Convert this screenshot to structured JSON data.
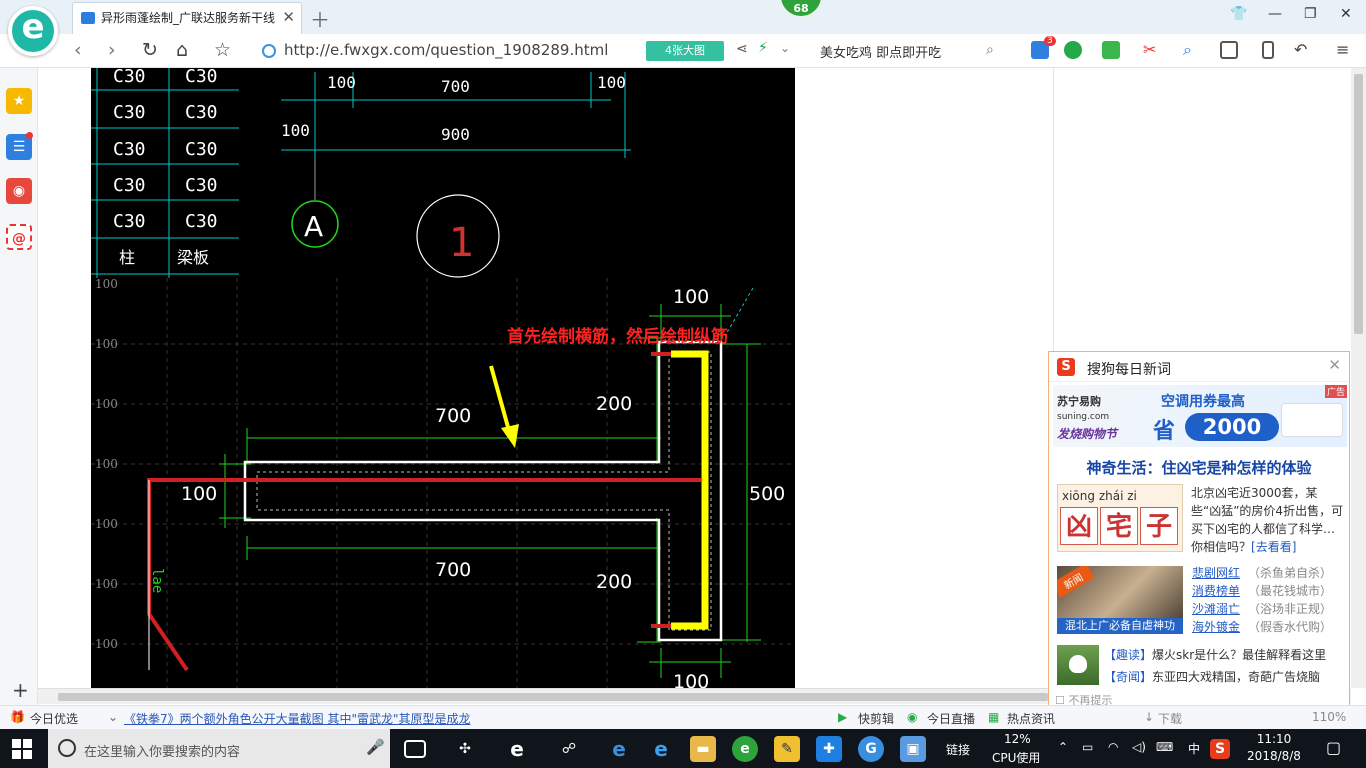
{
  "tabs": [
    {
      "title": "异形雨蓬绘制_广联达服务新干线"
    }
  ],
  "score_badge": "68",
  "address_bar": {
    "url": "http://e.fwxgx.com/question_1908289.html",
    "big_pic_label": "4张大图",
    "search_hint": "美女吃鸡 即点即开吃"
  },
  "ext_badge_count": "3",
  "cad": {
    "table_rows": [
      [
        "C30",
        "C30"
      ],
      [
        "C30",
        "C30"
      ],
      [
        "C30",
        "C30"
      ],
      [
        "C30",
        "C30"
      ],
      [
        "C30",
        "C30"
      ]
    ],
    "table_footer": [
      "柱",
      "梁板"
    ],
    "top_dims": {
      "left": "100",
      "mid": "700",
      "right": "100",
      "total": "900",
      "side": "100"
    },
    "axis_a": "A",
    "section_no": "1",
    "annotation": "首先绘制横筋，然后绘制纵筋",
    "grid_label": "100",
    "dims": {
      "top_width": "100",
      "upper_arm": "700",
      "lower_arm": "700",
      "upper_200": "200",
      "lower_200": "200",
      "thickness": "100",
      "height": "500",
      "bottom_width": "100"
    },
    "lae": "lae"
  },
  "popup": {
    "title": "搜狗每日新词",
    "ad": {
      "brand": "苏宁易购",
      "brand_sub": "suning.com",
      "slogan": "发烧购物节",
      "text": "空调用券最高",
      "sheng": "省",
      "amount": "2000",
      "tag": "广告"
    },
    "headline": "神奇生活：住凶宅是种怎样的体验",
    "pinyin": "xiōng  zhái   zi",
    "hanzi": [
      "凶",
      "宅",
      "子"
    ],
    "desc": "北京凶宅近3000套，某些“凶猛”的房价4折出售，可买下凶宅的人都信了科学…你相信吗？",
    "desc_link": "[去看看]",
    "thumb2_tag": "新闻",
    "thumb2_caption": "混北上广必备自虐神功",
    "hot_items": [
      {
        "title": "悲剧网红",
        "note": "（杀鱼弟自杀）"
      },
      {
        "title": "消费榜单",
        "note": "（最花钱城市）"
      },
      {
        "title": "沙滩溺亡",
        "note": "（浴场非正规）"
      },
      {
        "title": "海外镀金",
        "note": "（假香水代购）"
      }
    ],
    "news": [
      {
        "tag": "【趣读】",
        "text": "爆火skr是什么？最佳解释看这里"
      },
      {
        "tag": "【奇闻】",
        "text": "东亚四大戏精国，奇葩广告烧脑"
      }
    ],
    "no_remind": "不再提示"
  },
  "statusbar": {
    "today_pick": "今日优选",
    "news": "《铁拳7》两个额外角色公开大量截图 其中\"雷武龙\"其原型是成龙",
    "quick_cut": "快剪辑",
    "live": "今日直播",
    "hot": "热点资讯",
    "download": "下载",
    "zoom": "110%"
  },
  "taskbar": {
    "search_placeholder": "在这里输入你要搜索的内容",
    "link_label": "链接",
    "cpu_pct": "12%",
    "cpu_label": "CPU使用",
    "ime": "中",
    "time": "11:10",
    "date": "2018/8/8"
  },
  "colors": {
    "cad_bg": "#000000",
    "cyan": "#00c8c8",
    "green": "#1fd41f",
    "red": "#d02020",
    "yellow": "#ffff00",
    "annotation": "#ff2020"
  }
}
